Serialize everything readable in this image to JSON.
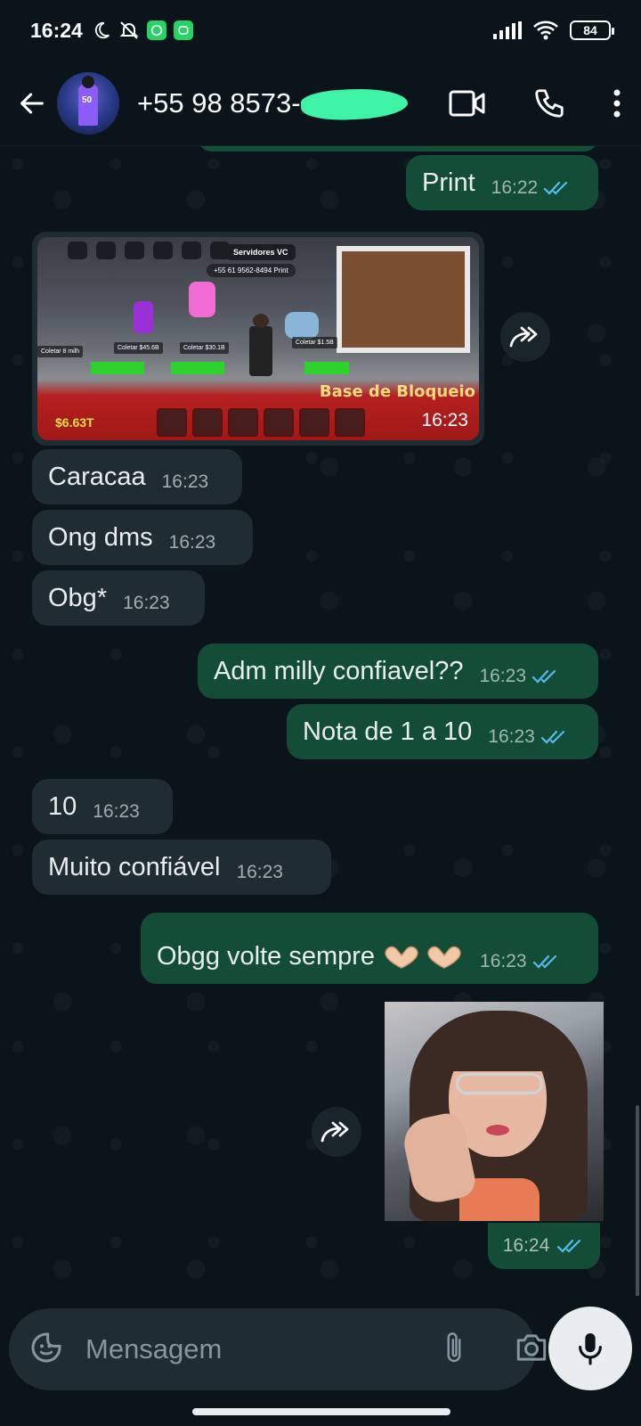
{
  "status_bar": {
    "time": "16:24",
    "battery": "84"
  },
  "header": {
    "contact": "+55 98 8573-",
    "video_label": "video-call",
    "call_label": "voice-call"
  },
  "image_message": {
    "time": "16:23",
    "game": {
      "server": "Servidores VC",
      "phone_chip": "+55 61 9562-8494  Print",
      "money": "$6.63T",
      "base_text": "Base de Bloqueio",
      "coletar_1": "Coletar $45.6B",
      "coletar_2": "Coletar $30.1B",
      "coletar_3": "Coletar $1.5B",
      "coletar_left": "Coletar 8 milh"
    }
  },
  "messages": [
    {
      "id": "m1",
      "direction": "out",
      "text": "Print",
      "time": "16:22"
    },
    {
      "id": "m2",
      "direction": "in",
      "text": "Caracaa",
      "time": "16:23"
    },
    {
      "id": "m3",
      "direction": "in",
      "text": "Ong dms",
      "time": "16:23"
    },
    {
      "id": "m4",
      "direction": "in",
      "text": "Obg*",
      "time": "16:23"
    },
    {
      "id": "m5",
      "direction": "out",
      "text": "Adm milly confiavel??",
      "time": "16:23"
    },
    {
      "id": "m6",
      "direction": "out",
      "text": "Nota de 1 a 10",
      "time": "16:23"
    },
    {
      "id": "m7",
      "direction": "in",
      "text": "10",
      "time": "16:23"
    },
    {
      "id": "m8",
      "direction": "in",
      "text": "Muito confiável",
      "time": "16:23"
    },
    {
      "id": "m9",
      "direction": "out",
      "text": "Obgg volte sempre",
      "time": "16:23"
    }
  ],
  "photo_message": {
    "time": "16:24"
  },
  "composer": {
    "placeholder": "Mensagem"
  },
  "colors": {
    "background": "#0b141a",
    "outgoing_bubble": "#144d37",
    "incoming_bubble": "#202c33",
    "read_tick": "#53bdeb",
    "redaction": "#3ef3a6"
  }
}
